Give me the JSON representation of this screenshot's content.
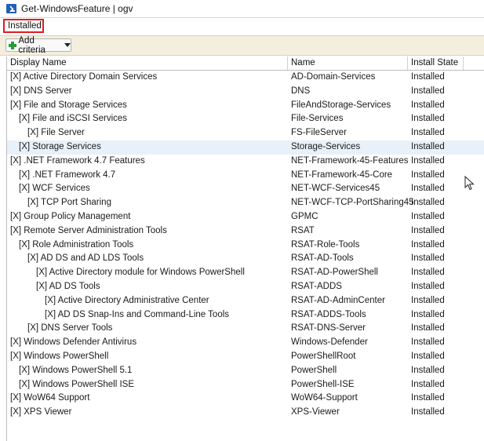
{
  "window": {
    "title": "Get-WindowsFeature | ogv",
    "icon": "powershell-icon"
  },
  "filter": {
    "value": "Installed"
  },
  "criteria": {
    "button_label": "Add criteria"
  },
  "columns": {
    "display_name": "Display Name",
    "name": "Name",
    "install_state": "Install State"
  },
  "rows": [
    {
      "display": "[X] Active Directory Domain Services",
      "name": "AD-Domain-Services",
      "state": "Installed",
      "indent": 0,
      "selected": false
    },
    {
      "display": "[X] DNS Server",
      "name": "DNS",
      "state": "Installed",
      "indent": 0,
      "selected": false
    },
    {
      "display": "[X] File and Storage Services",
      "name": "FileAndStorage-Services",
      "state": "Installed",
      "indent": 0,
      "selected": false
    },
    {
      "display": "[X] File and iSCSI Services",
      "name": "File-Services",
      "state": "Installed",
      "indent": 1,
      "selected": false
    },
    {
      "display": "[X] File Server",
      "name": "FS-FileServer",
      "state": "Installed",
      "indent": 2,
      "selected": false
    },
    {
      "display": "[X] Storage Services",
      "name": "Storage-Services",
      "state": "Installed",
      "indent": 1,
      "selected": true
    },
    {
      "display": "[X] .NET Framework 4.7 Features",
      "name": "NET-Framework-45-Features",
      "state": "Installed",
      "indent": 0,
      "selected": false
    },
    {
      "display": "[X] .NET Framework 4.7",
      "name": "NET-Framework-45-Core",
      "state": "Installed",
      "indent": 1,
      "selected": false
    },
    {
      "display": "[X] WCF Services",
      "name": "NET-WCF-Services45",
      "state": "Installed",
      "indent": 1,
      "selected": false
    },
    {
      "display": "[X] TCP Port Sharing",
      "name": "NET-WCF-TCP-PortSharing45",
      "state": "Installed",
      "indent": 2,
      "selected": false
    },
    {
      "display": "[X] Group Policy Management",
      "name": "GPMC",
      "state": "Installed",
      "indent": 0,
      "selected": false
    },
    {
      "display": "[X] Remote Server Administration Tools",
      "name": "RSAT",
      "state": "Installed",
      "indent": 0,
      "selected": false
    },
    {
      "display": "[X] Role Administration Tools",
      "name": "RSAT-Role-Tools",
      "state": "Installed",
      "indent": 1,
      "selected": false
    },
    {
      "display": "[X] AD DS and AD LDS Tools",
      "name": "RSAT-AD-Tools",
      "state": "Installed",
      "indent": 2,
      "selected": false
    },
    {
      "display": "[X] Active Directory module for Windows PowerShell",
      "name": "RSAT-AD-PowerShell",
      "state": "Installed",
      "indent": 3,
      "selected": false
    },
    {
      "display": "[X] AD DS Tools",
      "name": "RSAT-ADDS",
      "state": "Installed",
      "indent": 3,
      "selected": false
    },
    {
      "display": "[X] Active Directory Administrative Center",
      "name": "RSAT-AD-AdminCenter",
      "state": "Installed",
      "indent": 4,
      "selected": false
    },
    {
      "display": "[X] AD DS Snap-Ins and Command-Line Tools",
      "name": "RSAT-ADDS-Tools",
      "state": "Installed",
      "indent": 4,
      "selected": false
    },
    {
      "display": "[X] DNS Server Tools",
      "name": "RSAT-DNS-Server",
      "state": "Installed",
      "indent": 2,
      "selected": false
    },
    {
      "display": "[X] Windows Defender Antivirus",
      "name": "Windows-Defender",
      "state": "Installed",
      "indent": 0,
      "selected": false
    },
    {
      "display": "[X] Windows PowerShell",
      "name": "PowerShellRoot",
      "state": "Installed",
      "indent": 0,
      "selected": false
    },
    {
      "display": "[X] Windows PowerShell 5.1",
      "name": "PowerShell",
      "state": "Installed",
      "indent": 1,
      "selected": false
    },
    {
      "display": "[X] Windows PowerShell ISE",
      "name": "PowerShell-ISE",
      "state": "Installed",
      "indent": 1,
      "selected": false
    },
    {
      "display": "[X] WoW64 Support",
      "name": "WoW64-Support",
      "state": "Installed",
      "indent": 0,
      "selected": false
    },
    {
      "display": "[X] XPS Viewer",
      "name": "XPS-Viewer",
      "state": "Installed",
      "indent": 0,
      "selected": false
    }
  ]
}
